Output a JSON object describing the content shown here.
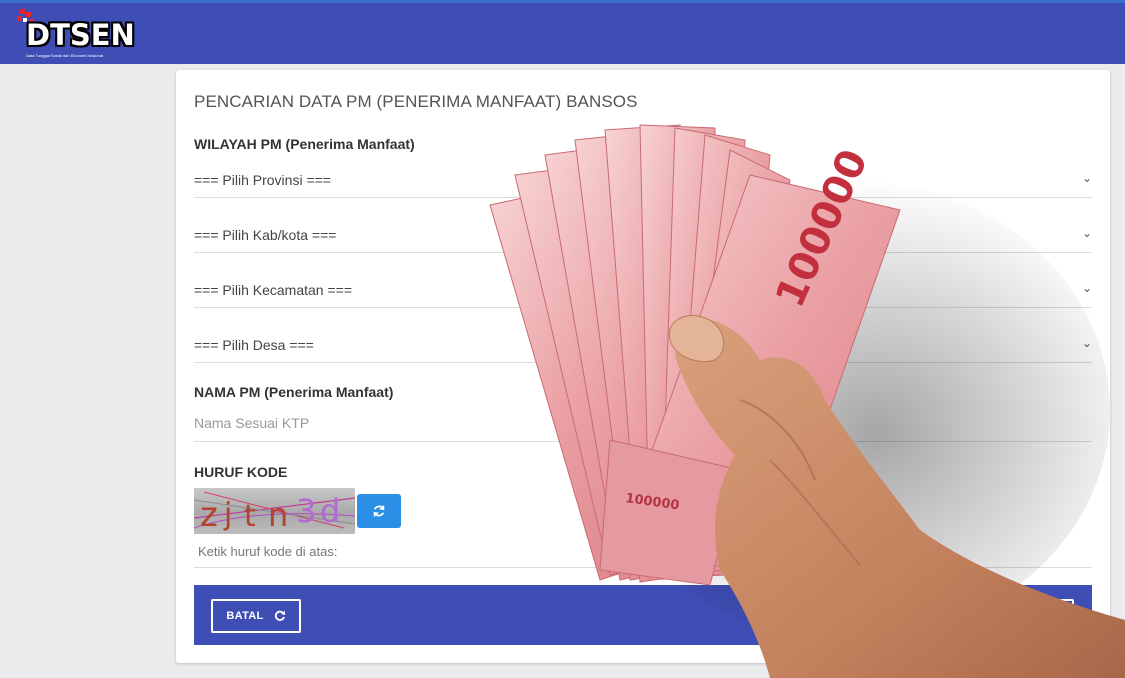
{
  "header": {
    "logo_text": "DTSEN",
    "logo_tagline": "Data Tunggal Sosial dan Ekonomi Nasional"
  },
  "form": {
    "title": "PENCARIAN DATA PM (PENERIMA MANFAAT) BANSOS",
    "wilayah_label": "WILAYAH PM (Penerima Manfaat)",
    "selects": [
      {
        "value": "=== Pilih Provinsi ==="
      },
      {
        "value": "=== Pilih Kab/kota ==="
      },
      {
        "value": "=== Pilih Kecamatan ==="
      },
      {
        "value": "=== Pilih Desa ==="
      }
    ],
    "nama_label": "NAMA PM (Penerima Manfaat)",
    "nama_placeholder": "Nama Sesuai KTP",
    "kode_label": "HURUF KODE",
    "captcha_text": "zjtn3d",
    "kode_placeholder": "Ketik huruf kode di atas:",
    "batal_label": "BATAL"
  },
  "photo": {
    "banknote_value": "100000",
    "banknote_small": "100000"
  },
  "colors": {
    "header_bg": "#3f4eb5",
    "refresh_btn": "#2b8fe6",
    "page_bg": "#ebebed"
  }
}
